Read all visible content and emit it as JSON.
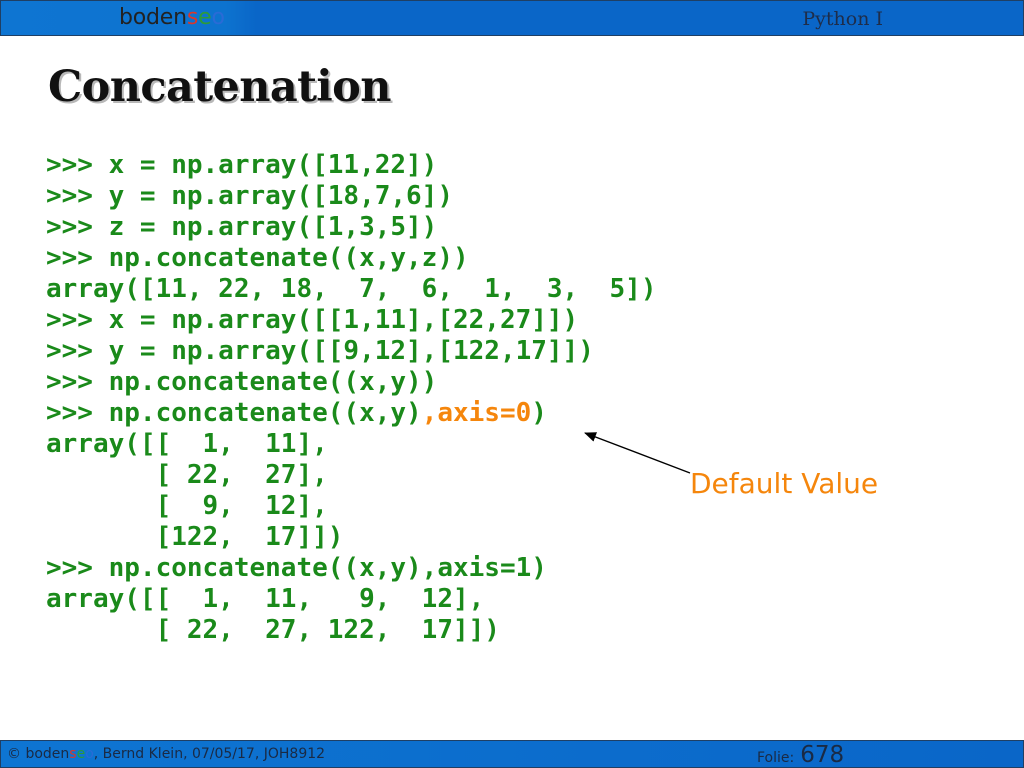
{
  "header": {
    "logo_parts": [
      "boden",
      "s",
      "e",
      "o"
    ],
    "course": "Python I"
  },
  "slide": {
    "title": "Concatenation"
  },
  "code": {
    "lines": [
      ">>> x = np.array([11,22])",
      ">>> y = np.array([18,7,6])",
      ">>> z = np.array([1,3,5])",
      ">>> np.concatenate((x,y,z))",
      "array([11, 22, 18,  7,  6,  1,  3,  5])",
      ">>> x = np.array([[1,11],[22,27]])",
      ">>> y = np.array([[9,12],[122,17]])",
      ">>> np.concatenate((x,y))",
      ">>> np.concatenate((x,y)",
      "array([[  1,  11],",
      "       [ 22,  27],",
      "       [  9,  12],",
      "       [122,  17]])",
      ">>> np.concatenate((x,y),axis=1)",
      "array([[  1,  11,   9,  12],",
      "       [ 22,  27, 122,  17]])"
    ],
    "highlight_text": ",axis=0",
    "highlight_tail": ")"
  },
  "annotation": {
    "text": "Default Value"
  },
  "footer": {
    "copyright": "©",
    "logo_parts": [
      "boden",
      "s",
      "e",
      "o"
    ],
    "details": ", Bernd Klein, 07/05/17, JOH8912",
    "folie_label": "Folie:",
    "folie_number": "678"
  },
  "colors": {
    "code_green": "#1a8a1a",
    "highlight_orange": "#f5860c",
    "header_blue": "#0a66c8"
  }
}
